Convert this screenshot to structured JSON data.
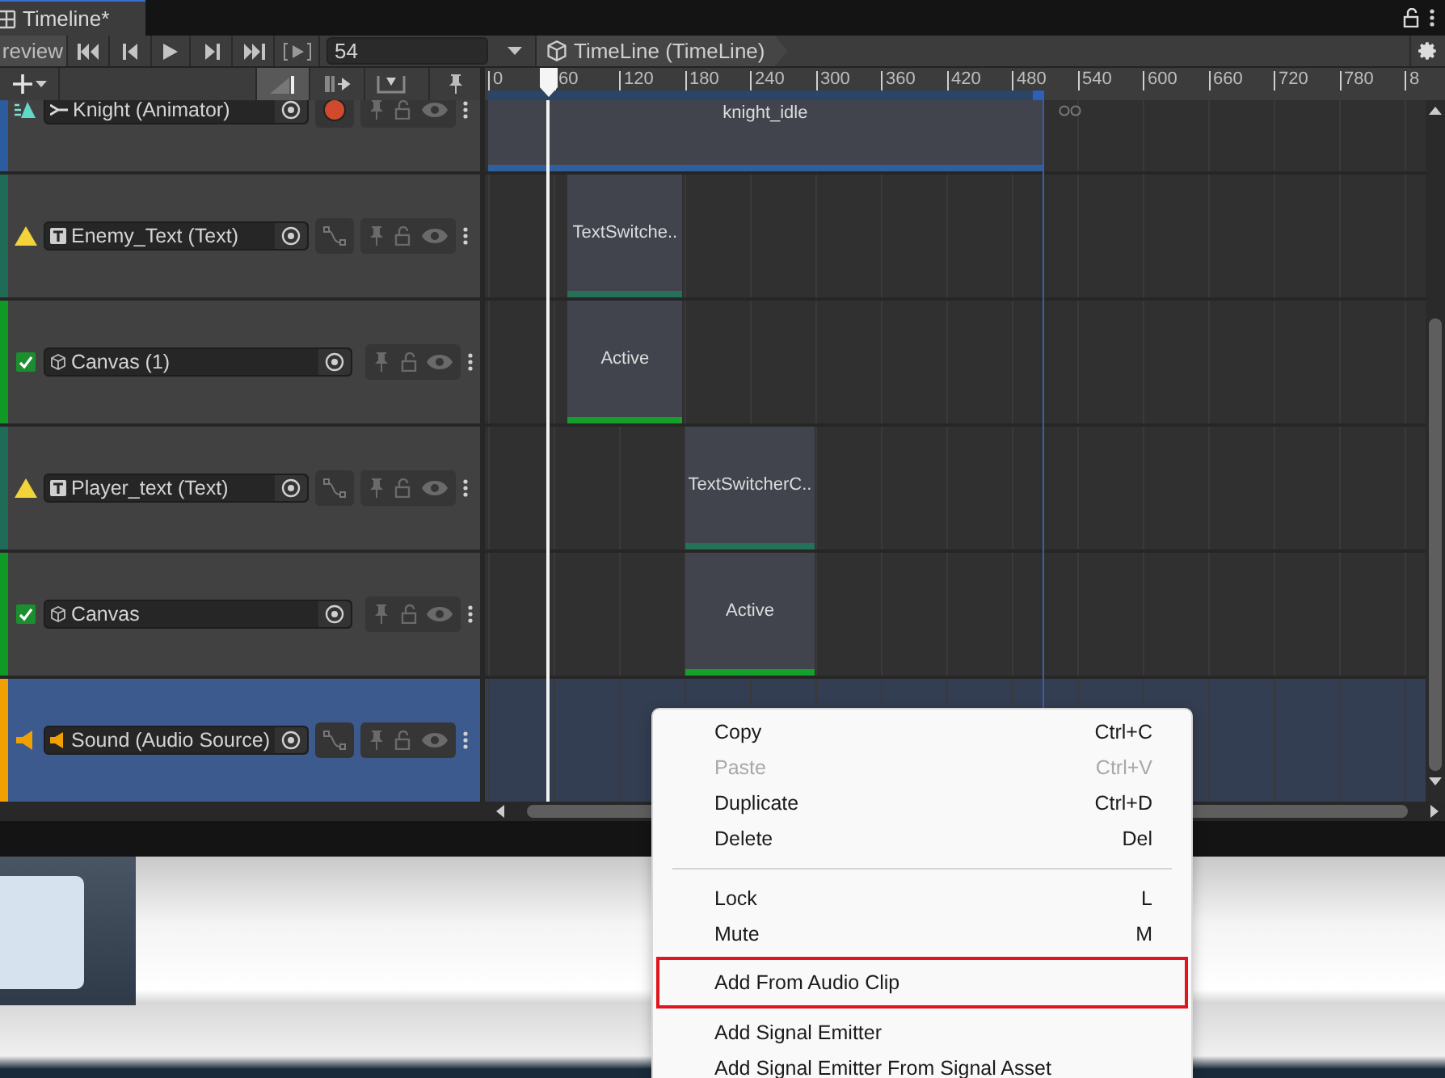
{
  "tab": {
    "title": "Timeline*"
  },
  "toolbar": {
    "preview_label": "review",
    "frame": "54",
    "breadcrumb": "TimeLine (TimeLine)"
  },
  "ruler": {
    "labels": [
      "0",
      "60",
      "120",
      "180",
      "240",
      "300",
      "360",
      "420",
      "480",
      "540",
      "600",
      "660",
      "720",
      "780",
      "8"
    ]
  },
  "tracks": [
    {
      "name": "Knight (Animator)",
      "kind": "animator",
      "color": "#2d5c9e",
      "selected": false,
      "clips": [
        {
          "label": "knight_idle"
        }
      ]
    },
    {
      "name": "Enemy_Text (Text)",
      "kind": "text",
      "color": "#1f6b58",
      "selected": false,
      "clips": [
        {
          "label": "TextSwitche.."
        }
      ]
    },
    {
      "name": "Canvas (1)",
      "kind": "activation",
      "color": "#0f9a25",
      "selected": false,
      "clips": [
        {
          "label": "Active"
        }
      ]
    },
    {
      "name": "Player_text (Text)",
      "kind": "text",
      "color": "#1f6b58",
      "selected": false,
      "clips": [
        {
          "label": "TextSwitcherC.."
        }
      ]
    },
    {
      "name": "Canvas",
      "kind": "activation",
      "color": "#0f9a25",
      "selected": false,
      "clips": [
        {
          "label": "Active"
        }
      ]
    },
    {
      "name": "Sound (Audio Source)",
      "kind": "audio",
      "color": "#f0a000",
      "selected": true
    }
  ],
  "menu": {
    "items": [
      {
        "kind": "item",
        "label": "Copy",
        "shortcut": "Ctrl+C",
        "disabled": false,
        "outlined": false
      },
      {
        "kind": "item",
        "label": "Paste",
        "shortcut": "Ctrl+V",
        "disabled": true,
        "outlined": false
      },
      {
        "kind": "item",
        "label": "Duplicate",
        "shortcut": "Ctrl+D",
        "disabled": false,
        "outlined": false
      },
      {
        "kind": "item",
        "label": "Delete",
        "shortcut": "Del",
        "disabled": false,
        "outlined": false
      },
      {
        "kind": "separator"
      },
      {
        "kind": "item",
        "label": "Lock",
        "shortcut": "L",
        "disabled": false,
        "outlined": false
      },
      {
        "kind": "item",
        "label": "Mute",
        "shortcut": "M",
        "disabled": false,
        "outlined": false
      },
      {
        "kind": "item",
        "label": "Add From Audio Clip",
        "disabled": false,
        "outlined": true
      },
      {
        "kind": "item",
        "label": "Add Signal Emitter",
        "disabled": false,
        "outlined": false
      },
      {
        "kind": "item",
        "label": "Add Signal Emitter From Signal Asset",
        "disabled": false,
        "outlined": false
      }
    ]
  }
}
